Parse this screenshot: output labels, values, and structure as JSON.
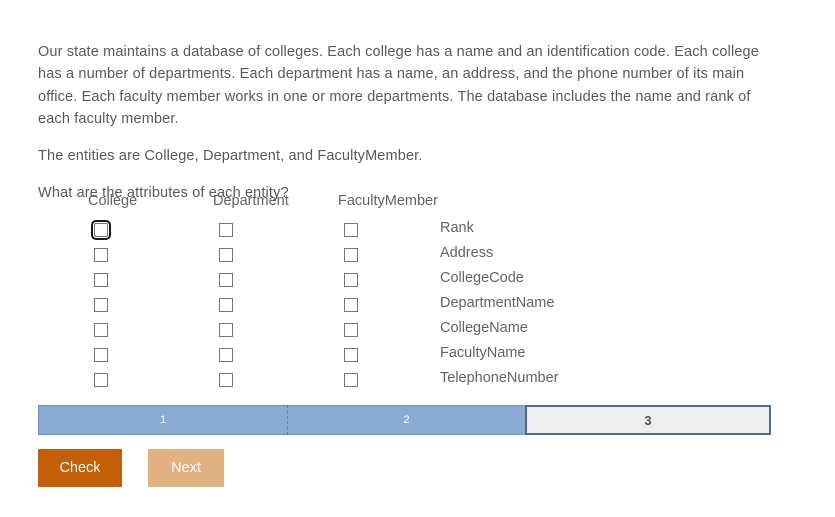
{
  "problem": {
    "statement": "Our state maintains a database of colleges. Each college has a name and an identification code. Each college has a number of departments. Each department has a name, an address, and the phone number of its main office. Each faculty member works in one or more departments. The database includes the name and rank of each faculty member.",
    "entities_line": "The entities are College, Department, and FacultyMember.",
    "question": "What are the attributes of each entity?"
  },
  "grid": {
    "columns": [
      "College",
      "Department",
      "FacultyMember"
    ],
    "rows": [
      {
        "label": "Rank",
        "checked": [
          false,
          false,
          false
        ],
        "focused_column": 0
      },
      {
        "label": "Address",
        "checked": [
          false,
          false,
          false
        ],
        "focused_column": -1
      },
      {
        "label": "CollegeCode",
        "checked": [
          false,
          false,
          false
        ],
        "focused_column": -1
      },
      {
        "label": "DepartmentName",
        "checked": [
          false,
          false,
          false
        ],
        "focused_column": -1
      },
      {
        "label": "CollegeName",
        "checked": [
          false,
          false,
          false
        ],
        "focused_column": -1
      },
      {
        "label": "FacultyName",
        "checked": [
          false,
          false,
          false
        ],
        "focused_column": -1
      },
      {
        "label": "TelephoneNumber",
        "checked": [
          false,
          false,
          false
        ],
        "focused_column": -1
      }
    ]
  },
  "progress": {
    "steps": [
      {
        "label": "1",
        "state": "done"
      },
      {
        "label": "2",
        "state": "done"
      },
      {
        "label": "3",
        "state": "current"
      }
    ],
    "colors": {
      "done_fill": "#8aabd4",
      "current_fill": "#eeeeee",
      "current_border": "#4d6a96"
    }
  },
  "actions": {
    "check_label": "Check",
    "next_label": "Next",
    "colors": {
      "check_bg": "#c36006",
      "next_bg": "#e3b283"
    }
  }
}
